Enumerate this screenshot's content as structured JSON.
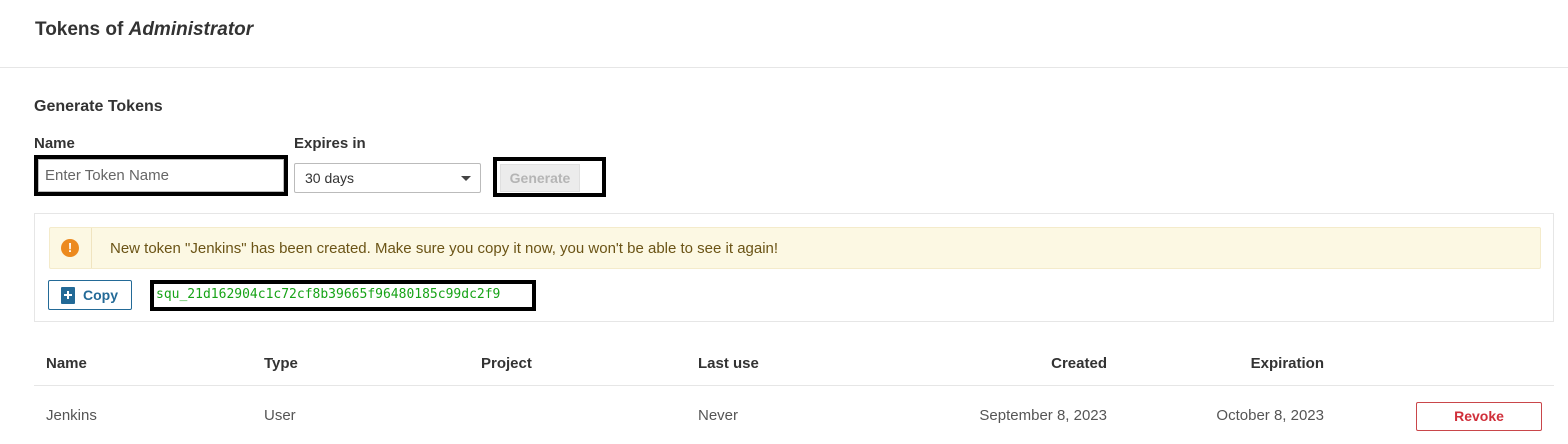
{
  "header": {
    "title_prefix": "Tokens of ",
    "title_user": "Administrator"
  },
  "generate": {
    "section_title": "Generate Tokens",
    "name_label": "Name",
    "name_placeholder": "Enter Token Name",
    "name_value": "",
    "expires_label": "Expires in",
    "expires_value": "30 days",
    "generate_label": "Generate"
  },
  "new_token": {
    "alert_icon": "exclamation-icon",
    "message": "New token \"Jenkins\" has been created. Make sure you copy it now, you won't be able to see it again!",
    "copy_label": "Copy",
    "token_value": "squ_21d162904c1c72cf8b39665f96480185c99dc2f9"
  },
  "table": {
    "columns": {
      "name": "Name",
      "type": "Type",
      "project": "Project",
      "last_use": "Last use",
      "created": "Created",
      "expiration": "Expiration"
    },
    "rows": [
      {
        "name": "Jenkins",
        "type": "User",
        "project": "",
        "last_use": "Never",
        "created": "September 8, 2023",
        "expiration": "October 8, 2023",
        "action": "Revoke"
      }
    ]
  },
  "colors": {
    "accent_blue": "#236a97",
    "token_green": "#17a317",
    "warning_bg": "#fcf8e3",
    "warning_icon": "#ec8a1f",
    "revoke_red": "#d02f3a"
  }
}
